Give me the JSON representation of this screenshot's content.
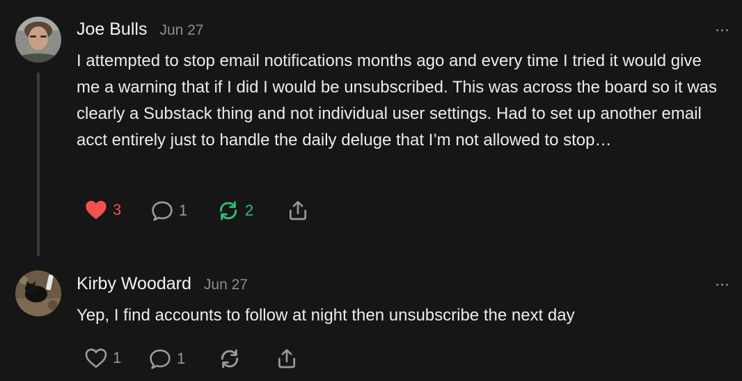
{
  "comments": [
    {
      "author": "Joe Bulls",
      "date": "Jun 27",
      "text": "I attempted to stop email notifications months ago and every time I tried it would give me a warning that if I did I would be unsubscribed. This was across the board so it was clearly a Substack thing and not individual user settings. Had to set up another email acct entirely just to handle the daily deluge that I’m not allowed to stop…",
      "likes": "3",
      "replies": "1",
      "restacks": "2",
      "liked": true,
      "restacked": true
    },
    {
      "author": "Kirby Woodard",
      "date": "Jun 27",
      "text": "Yep, I find accounts to follow at night then unsubscribe the next day",
      "likes": "1",
      "replies": "1",
      "liked": false,
      "restacked": false
    }
  ],
  "icons": {
    "like": "heart-icon",
    "reply": "comment-bubble-icon",
    "restack": "restack-icon",
    "share": "share-icon",
    "more": "ellipsis-icon"
  },
  "colors": {
    "background": "#161616",
    "like_active": "#f0524f",
    "restack_active": "#2fc07a",
    "muted": "#9a9a9a"
  }
}
